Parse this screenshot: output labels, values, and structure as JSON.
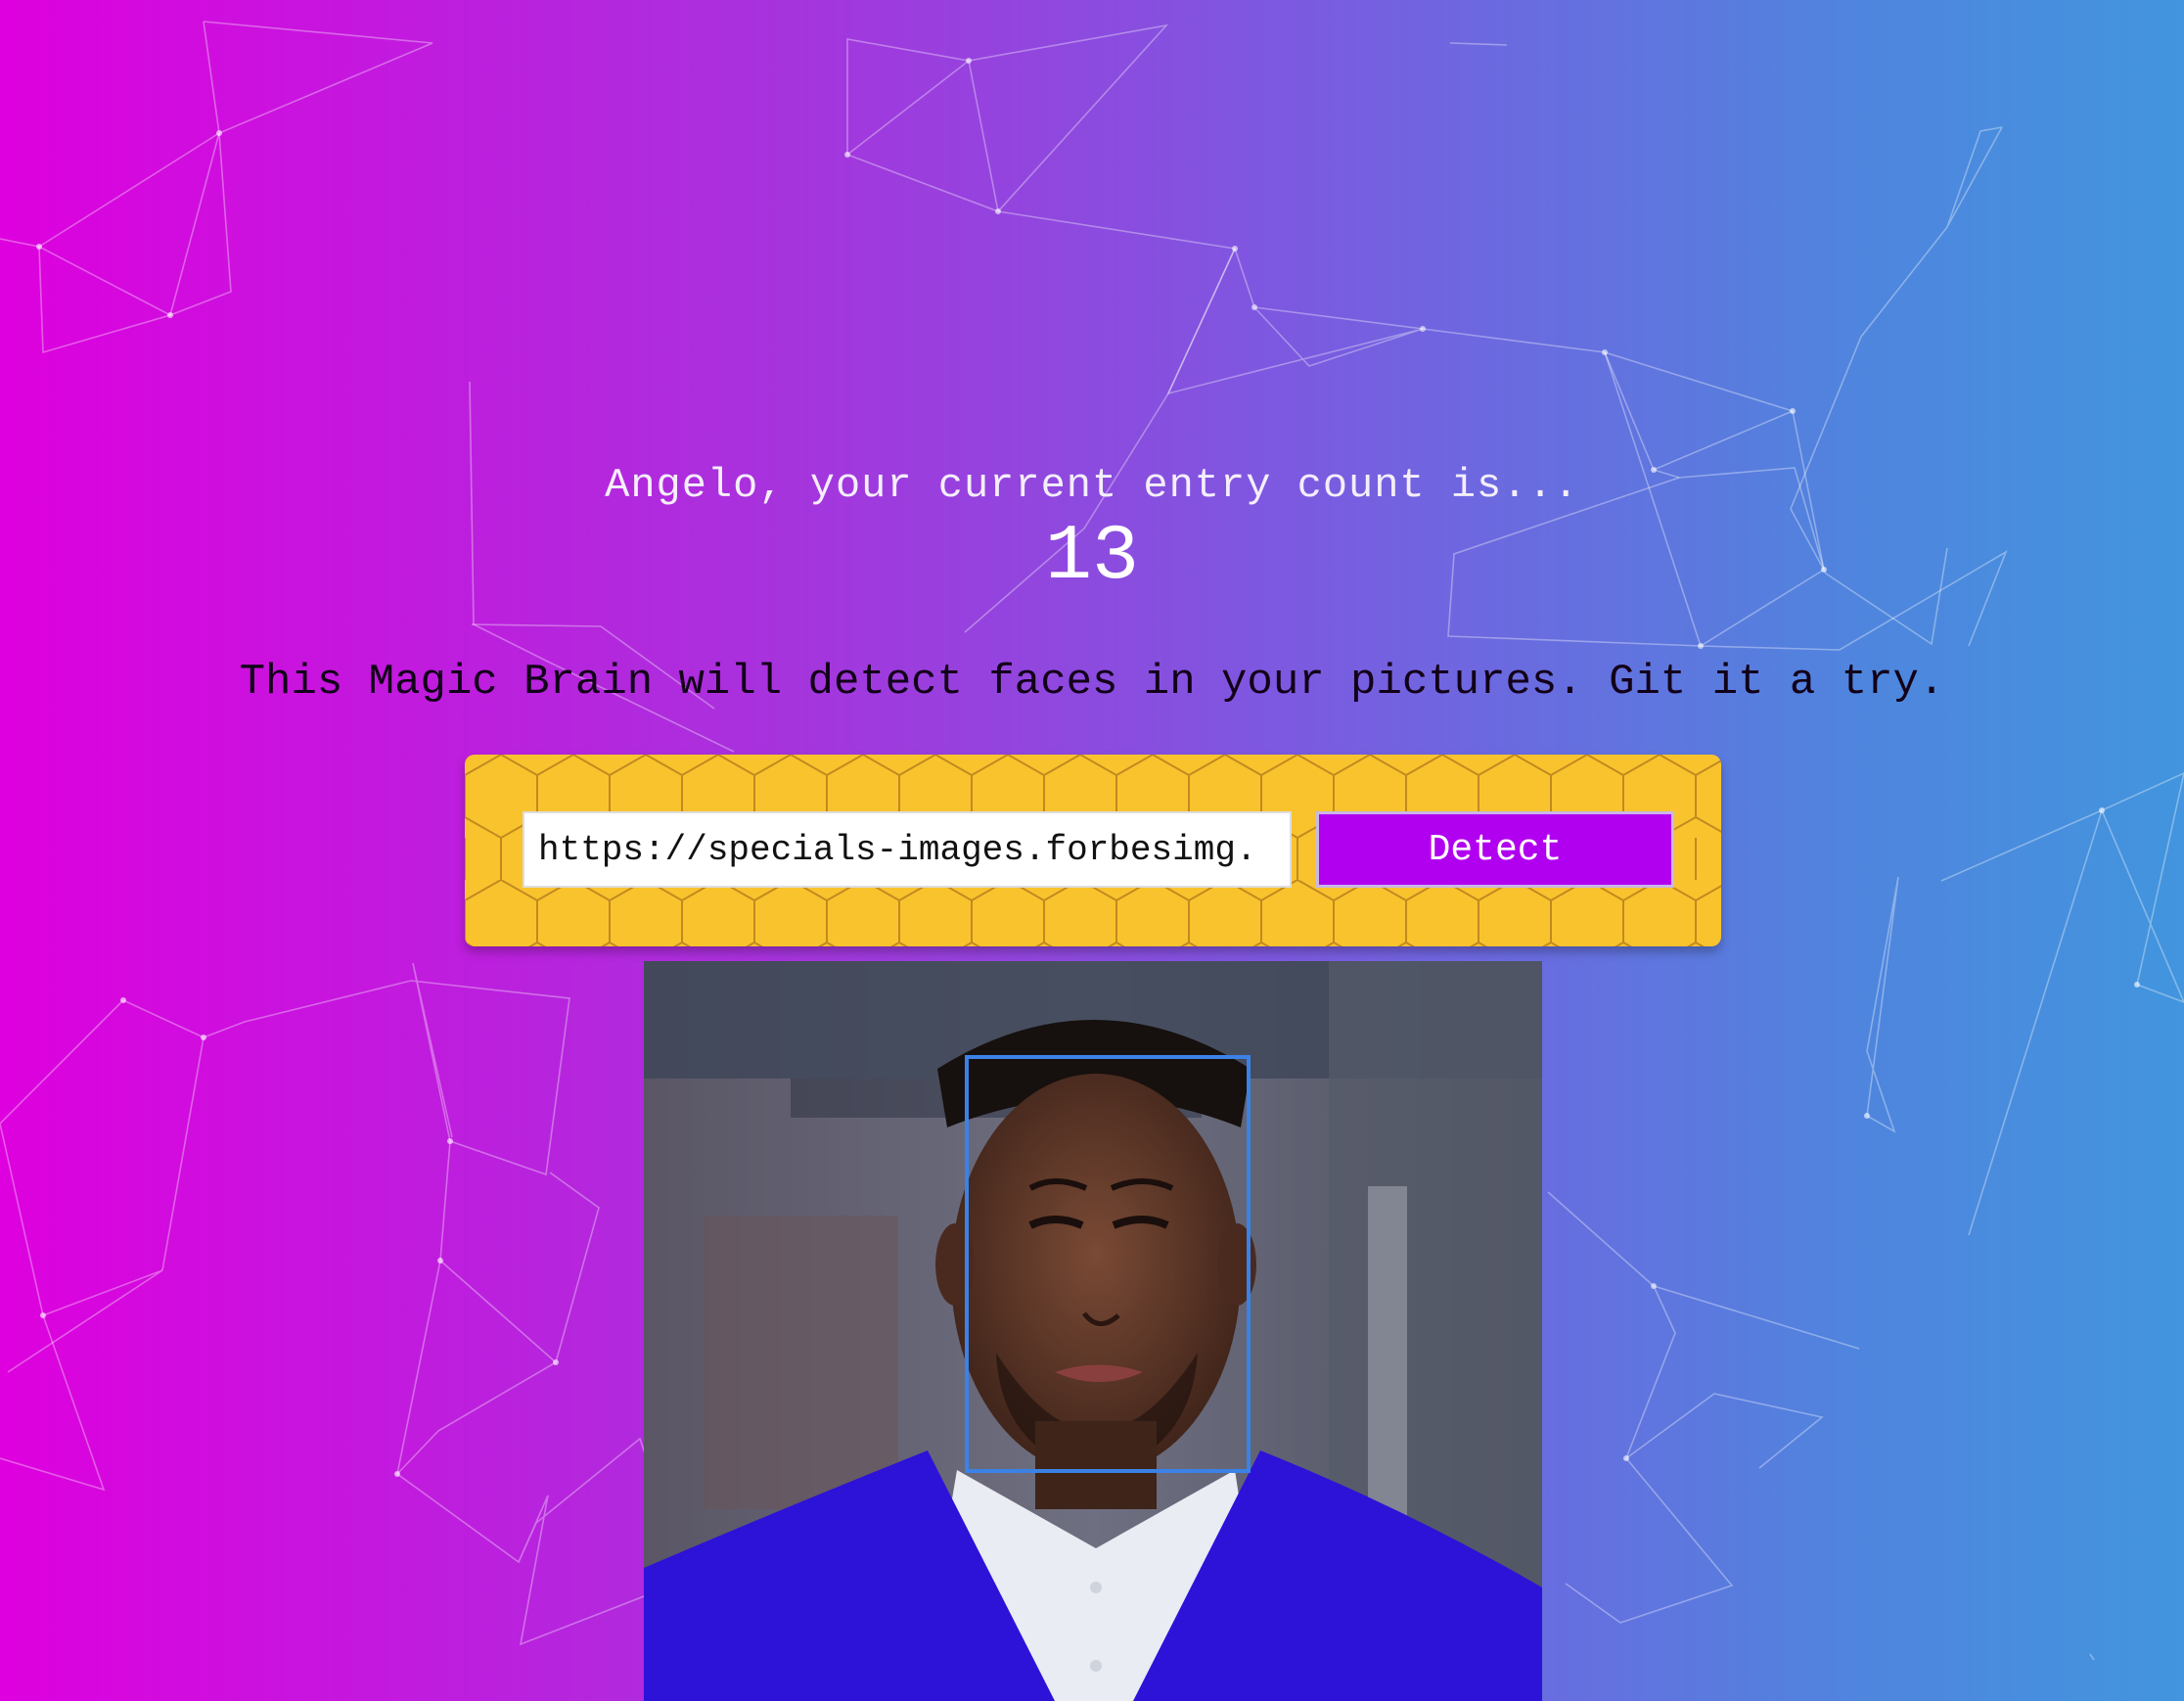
{
  "rank": {
    "message": "Angelo, your current entry count is...",
    "count": "13"
  },
  "intro": {
    "text": "This Magic Brain will detect faces in your pictures. Git it a try."
  },
  "form": {
    "url_value": "https://specials-images.forbesimg.",
    "detect_label": "Detect"
  },
  "colors": {
    "form_panel": "#f9c32e",
    "detect_button": "#b100f0",
    "face_box": "#3b82e6",
    "gradient_left": "#de00de",
    "gradient_right": "#4295de"
  },
  "icons": [
    "face-bounding-box"
  ]
}
